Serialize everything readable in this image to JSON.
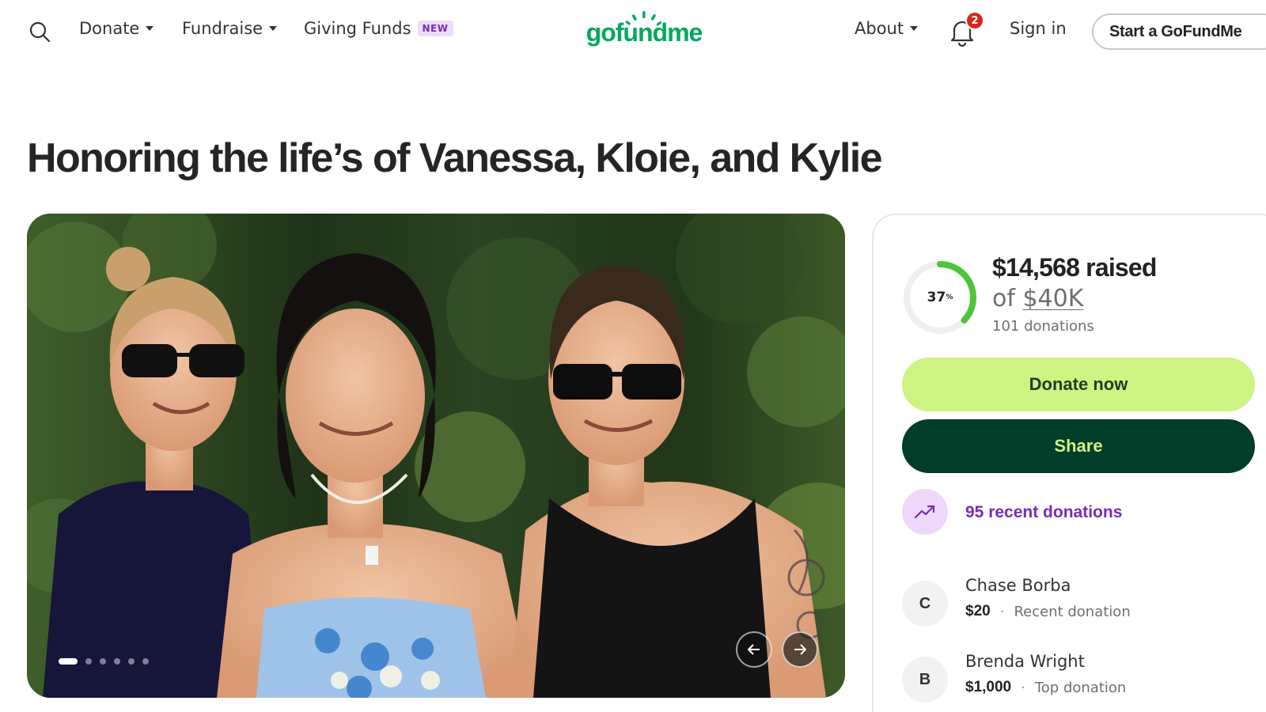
{
  "nav": {
    "donate_label": "Donate",
    "fundraise_label": "Fundraise",
    "giving_funds_label": "Giving Funds",
    "giving_funds_badge": "NEW",
    "logo_text": "gofundme",
    "notifications_count": "2",
    "signin_label": "Sign in",
    "about_label": "About",
    "start_label": "Start a GoFundMe"
  },
  "campaign": {
    "title": "Honoring the life’s of Vanessa, Kloie, and Kylie",
    "progress_percent": 37,
    "progress_label": "37",
    "progress_suffix": "%",
    "raised_text": "$14,568 raised",
    "goal_prefix": "of ",
    "goal_amount": "$40K",
    "donation_count": "101 donations",
    "donate_button": "Donate now",
    "share_button": "Share",
    "recent_donations": "95 recent donations"
  },
  "gallery": {
    "slide_count": 6,
    "active_slide": 1
  },
  "donors": [
    {
      "initial": "C",
      "name": "Chase Borba",
      "amount": "$20",
      "label": "Recent donation"
    },
    {
      "initial": "B",
      "name": "Brenda Wright",
      "amount": "$1,000",
      "label": "Top donation"
    }
  ],
  "colors": {
    "accent_green": "#cdf382",
    "dark_green": "#013d29",
    "logo_green": "#02a95c",
    "purple": "#7a2bb5",
    "badge_red": "#d9261c"
  }
}
